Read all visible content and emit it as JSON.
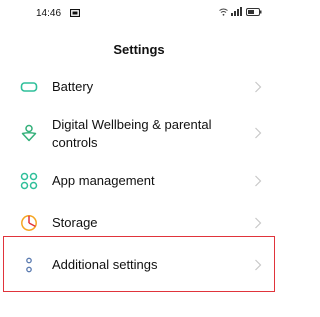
{
  "status_bar": {
    "time": "14:46",
    "icons": [
      "notification-icon",
      "wifi-icon",
      "signal-icon",
      "battery-icon"
    ]
  },
  "header": {
    "title": "Settings"
  },
  "settings_items": [
    {
      "label": "Battery",
      "icon": "battery-icon",
      "color": "#2fbf9a"
    },
    {
      "label_line1": "Digital Wellbeing & parental",
      "label_line2": "controls",
      "icon": "wellbeing-icon",
      "color": "#34b07a"
    },
    {
      "label": "App management",
      "icon": "apps-icon",
      "color": "#2fbf9a"
    },
    {
      "label": "Storage",
      "icon": "storage-icon",
      "color": "#f5a623"
    },
    {
      "label": "Additional settings",
      "icon": "more-icon",
      "color": "#5b7bb0"
    }
  ],
  "colors": {
    "highlight": "#e0343b",
    "chevron": "#c8c8c8"
  }
}
